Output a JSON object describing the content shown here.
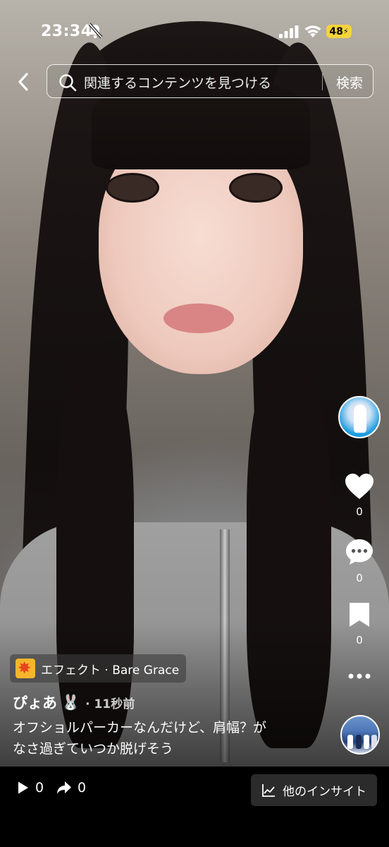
{
  "status_bar": {
    "time": "23:34",
    "battery": "48",
    "bell_icon": "bell-slash-icon",
    "signal_icon": "cellular-signal-icon",
    "wifi_icon": "wifi-icon"
  },
  "search": {
    "placeholder": "関連するコンテンツを見つける",
    "button": "検索",
    "back_icon": "chevron-left-icon",
    "search_icon": "search-icon"
  },
  "actions": {
    "like_count": "0",
    "comment_count": "0",
    "save_count": "0",
    "like_icon": "heart-icon",
    "comment_icon": "speech-bubble-icon",
    "save_icon": "bookmark-icon",
    "more_icon": "more-dots-icon"
  },
  "post": {
    "effect_label": "エフェクト · Bare Grace",
    "username": "ぴょあ",
    "username_emoji": "🐰",
    "time_ago": "· 11秒前",
    "caption_line1": "オフショルパーカーなんだけど、肩幅？が",
    "caption_line2": "なさ過ぎていつか脱げそう"
  },
  "bottom_bar": {
    "play_count": "0",
    "share_count": "0",
    "insights_label": "他のインサイト",
    "play_icon": "play-icon",
    "share_icon": "share-arrow-icon",
    "insights_icon": "line-chart-icon"
  },
  "colors": {
    "battery": "#f5d33a",
    "effect_badge": "#f5b62b",
    "bottom_bar": "#000000",
    "insights_button": "#2b2b2b"
  }
}
